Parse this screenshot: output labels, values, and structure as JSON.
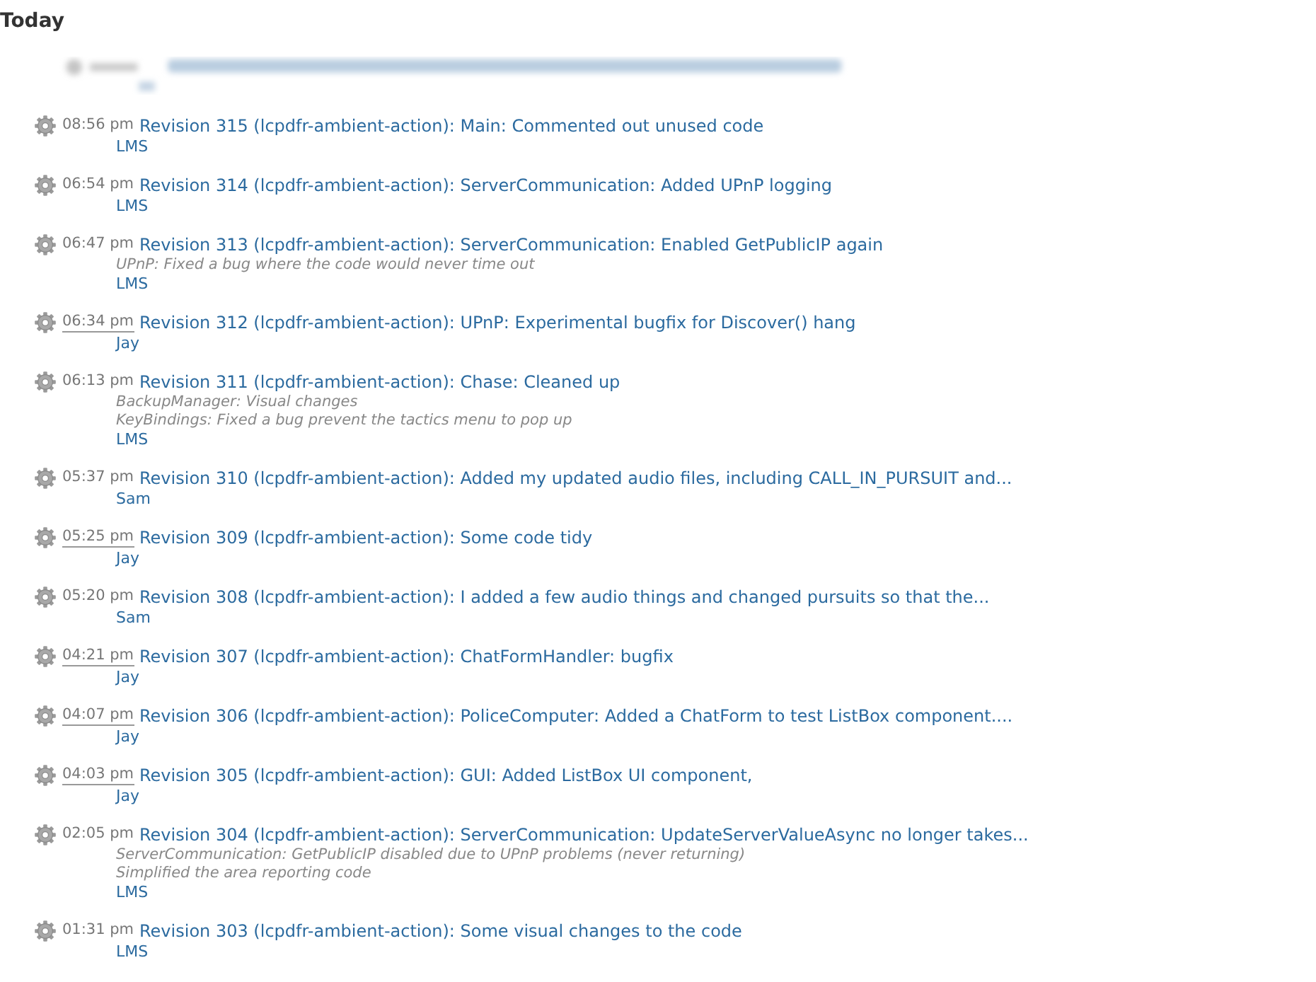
{
  "heading": "Today",
  "entries": [
    {
      "kind": "redacted"
    },
    {
      "kind": "revision",
      "time": "08:56 pm",
      "time_underlined": false,
      "title": "Revision 315 (lcpdfr-ambient-action): Main: Commented out unused code",
      "author": "LMS"
    },
    {
      "kind": "revision",
      "time": "06:54 pm",
      "time_underlined": false,
      "title": "Revision 314 (lcpdfr-ambient-action): ServerCommunication: Added UPnP logging",
      "author": "LMS"
    },
    {
      "kind": "revision",
      "time": "06:47 pm",
      "time_underlined": false,
      "title": "Revision 313 (lcpdfr-ambient-action): ServerCommunication: Enabled GetPublicIP again",
      "messages": [
        "UPnP: Fixed a bug where the code would never time out"
      ],
      "author": "LMS"
    },
    {
      "kind": "revision",
      "time": "06:34 pm",
      "time_underlined": true,
      "title": "Revision 312 (lcpdfr-ambient-action): UPnP: Experimental bugfix for Discover() hang",
      "author": "Jay"
    },
    {
      "kind": "revision",
      "time": "06:13 pm",
      "time_underlined": false,
      "title": "Revision 311 (lcpdfr-ambient-action): Chase: Cleaned up",
      "messages": [
        "BackupManager: Visual changes",
        "KeyBindings: Fixed a bug prevent the tactics menu to pop up"
      ],
      "author": "LMS"
    },
    {
      "kind": "revision",
      "time": "05:37 pm",
      "time_underlined": false,
      "title": "Revision 310 (lcpdfr-ambient-action): Added my updated audio files, including CALL_IN_PURSUIT and...",
      "author": "Sam"
    },
    {
      "kind": "revision",
      "time": "05:25 pm",
      "time_underlined": true,
      "title": "Revision 309 (lcpdfr-ambient-action): Some code tidy",
      "author": "Jay"
    },
    {
      "kind": "revision",
      "time": "05:20 pm",
      "time_underlined": false,
      "title": "Revision 308 (lcpdfr-ambient-action): I added a few audio things and changed pursuits so that the...",
      "author": "Sam"
    },
    {
      "kind": "revision",
      "time": "04:21 pm",
      "time_underlined": true,
      "title": "Revision 307 (lcpdfr-ambient-action): ChatFormHandler: bugfix",
      "author": "Jay"
    },
    {
      "kind": "revision",
      "time": "04:07 pm",
      "time_underlined": true,
      "title": "Revision 306 (lcpdfr-ambient-action): PoliceComputer: Added a ChatForm to test ListBox component....",
      "author": "Jay"
    },
    {
      "kind": "revision",
      "time": "04:03 pm",
      "time_underlined": true,
      "title": "Revision 305 (lcpdfr-ambient-action): GUI: Added ListBox UI component,",
      "author": "Jay"
    },
    {
      "kind": "revision",
      "time": "02:05 pm",
      "time_underlined": false,
      "title": "Revision 304 (lcpdfr-ambient-action): ServerCommunication: UpdateServerValueAsync no longer takes...",
      "messages": [
        "ServerCommunication: GetPublicIP disabled due to UPnP problems (never returning)",
        "Simplified the area reporting code"
      ],
      "author": "LMS"
    },
    {
      "kind": "revision",
      "time": "01:31 pm",
      "time_underlined": false,
      "title": "Revision 303 (lcpdfr-ambient-action): Some visual changes to the code",
      "author": "LMS"
    }
  ]
}
